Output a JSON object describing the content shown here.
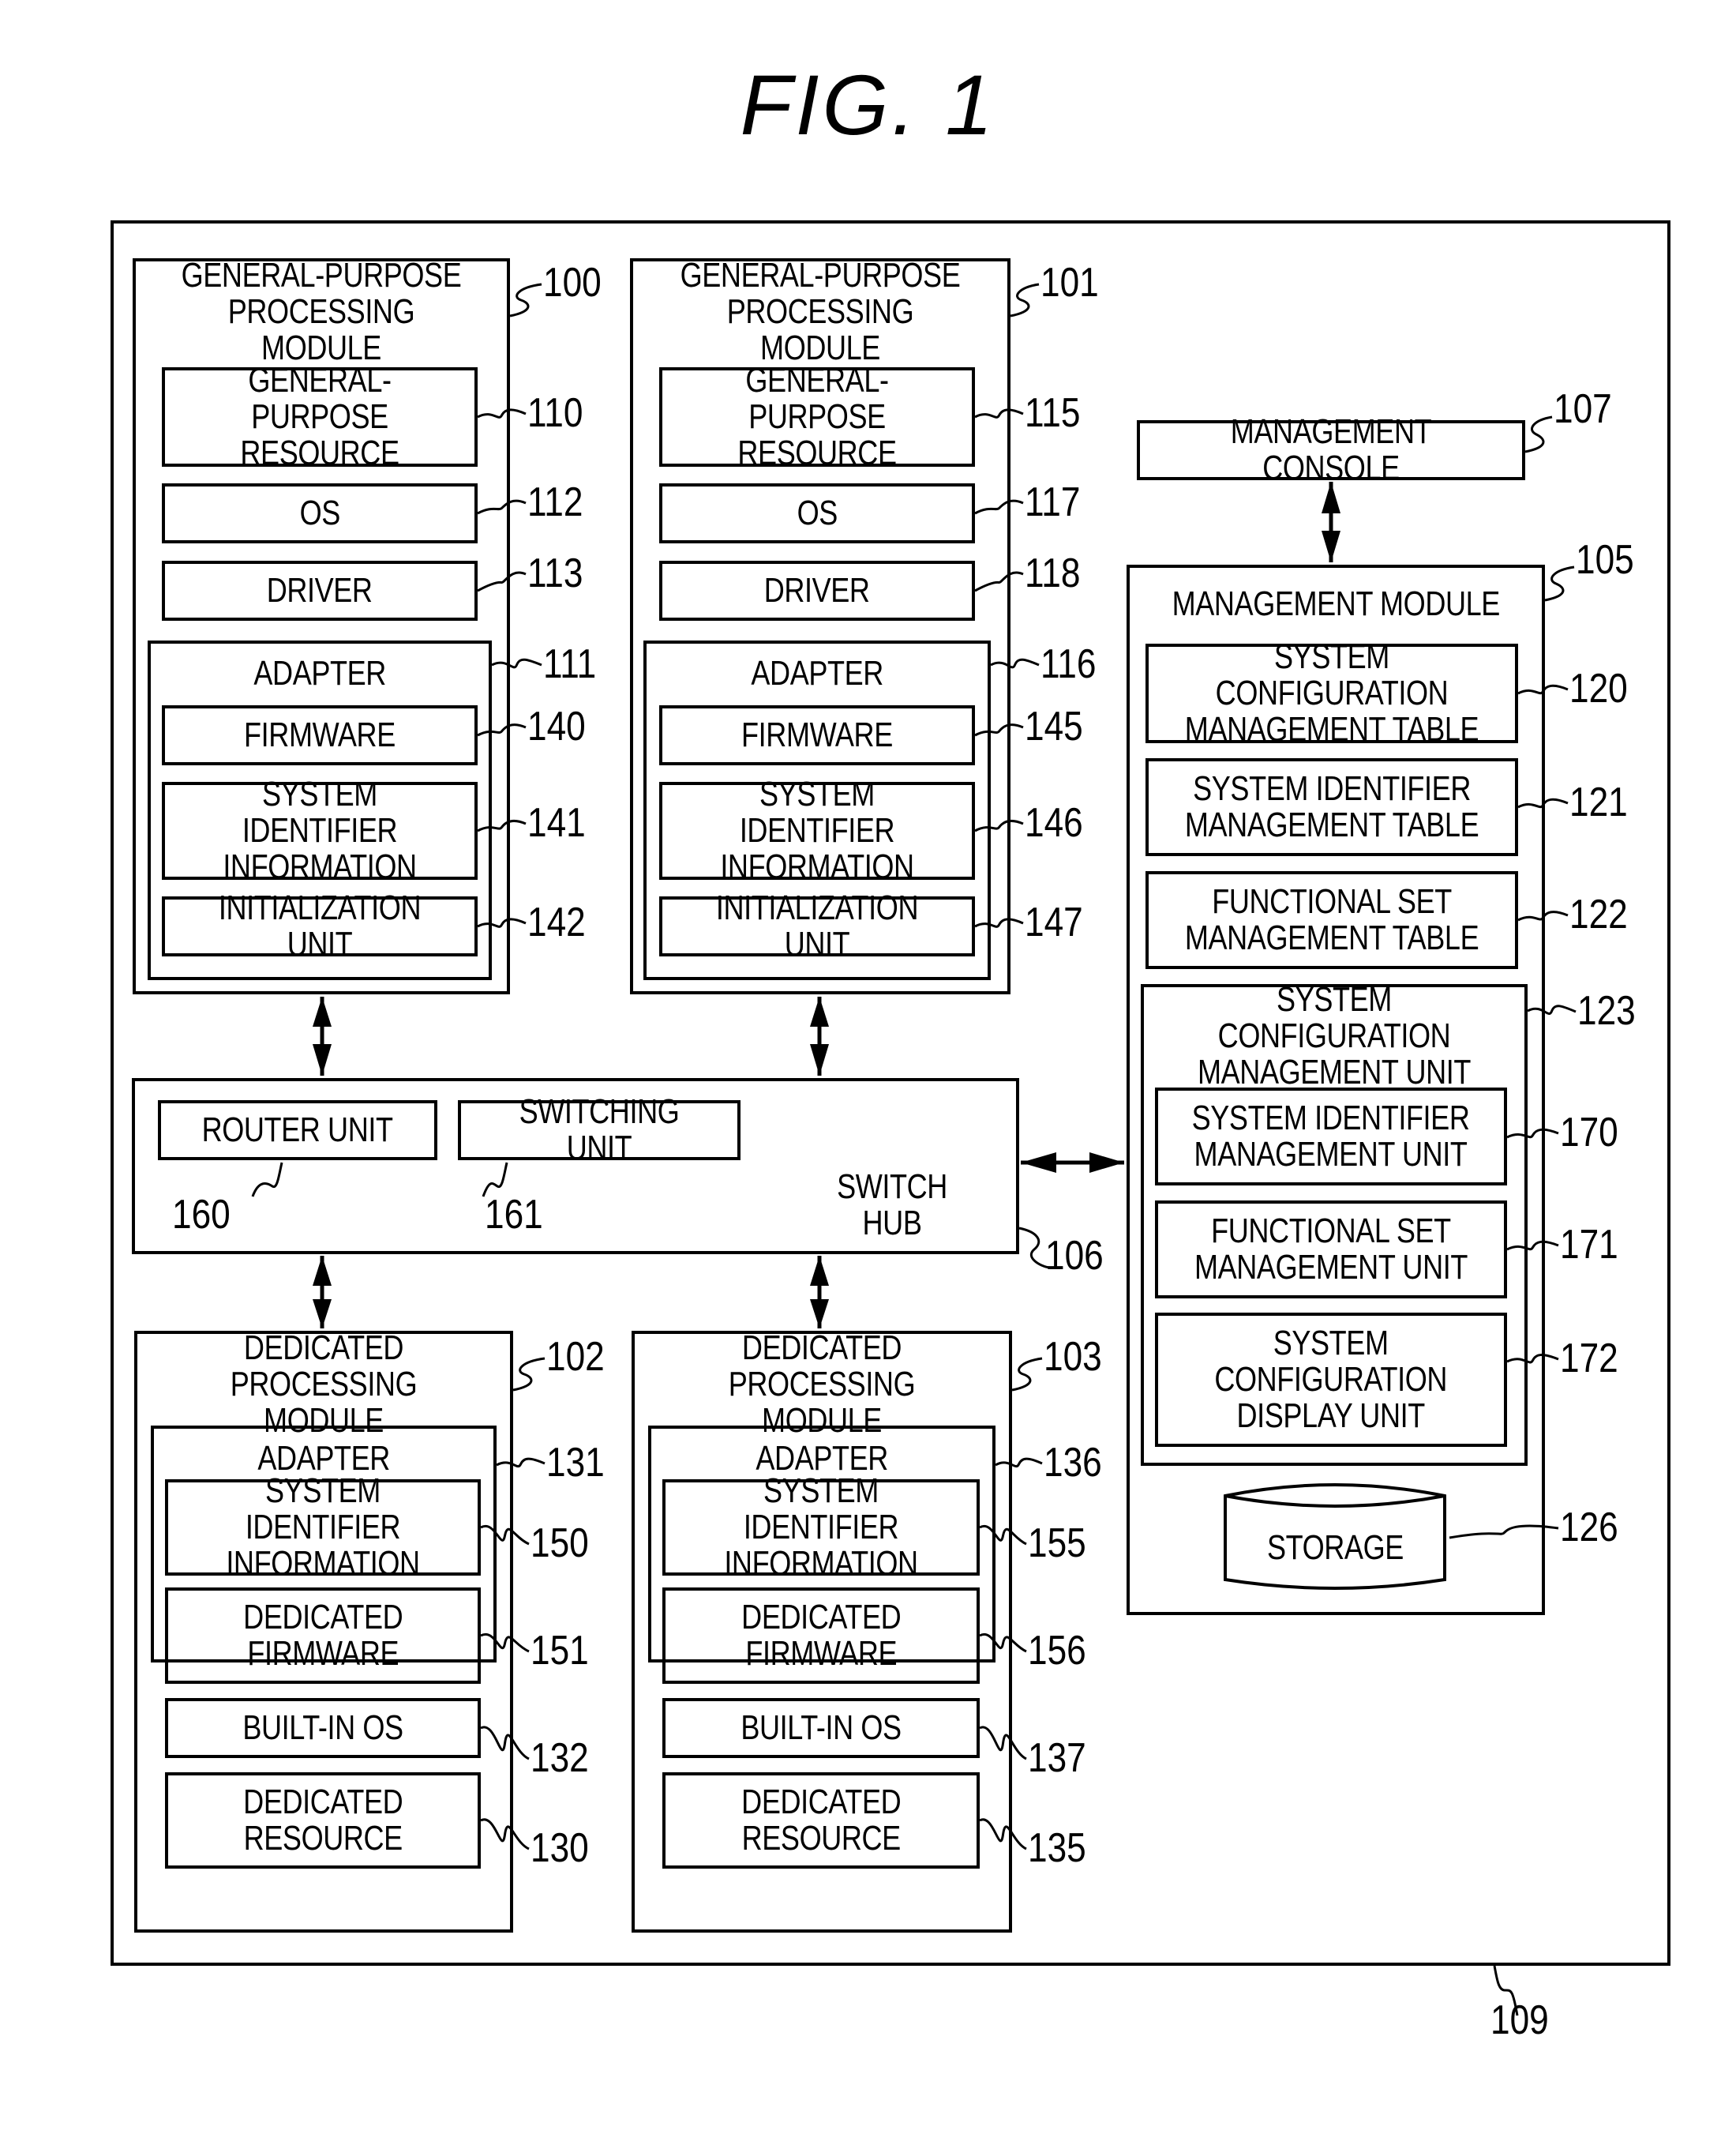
{
  "figure_title": "FIG.  1",
  "system": {
    "ref": "109"
  },
  "gp_modules": [
    {
      "title": "GENERAL-PURPOSE\nPROCESSING MODULE",
      "ref": "100",
      "resource": {
        "label": "GENERAL-PURPOSE\nRESOURCE",
        "ref": "110"
      },
      "os": {
        "label": "OS",
        "ref": "112"
      },
      "driver": {
        "label": "DRIVER",
        "ref": "113"
      },
      "adapter": {
        "label": "ADAPTER",
        "ref": "111",
        "firmware": {
          "label": "FIRMWARE",
          "ref": "140"
        },
        "sysid": {
          "label": "SYSTEM IDENTIFIER\nINFORMATION",
          "ref": "141"
        },
        "init": {
          "label": "INITIALIZATION UNIT",
          "ref": "142"
        }
      }
    },
    {
      "title": "GENERAL-PURPOSE\nPROCESSING MODULE",
      "ref": "101",
      "resource": {
        "label": "GENERAL-PURPOSE\nRESOURCE",
        "ref": "115"
      },
      "os": {
        "label": "OS",
        "ref": "117"
      },
      "driver": {
        "label": "DRIVER",
        "ref": "118"
      },
      "adapter": {
        "label": "ADAPTER",
        "ref": "116",
        "firmware": {
          "label": "FIRMWARE",
          "ref": "145"
        },
        "sysid": {
          "label": "SYSTEM IDENTIFIER\nINFORMATION",
          "ref": "146"
        },
        "init": {
          "label": "INITIALIZATION UNIT",
          "ref": "147"
        }
      }
    }
  ],
  "switch_hub": {
    "label": "SWITCH HUB",
    "ref": "106",
    "router": {
      "label": "ROUTER UNIT",
      "ref": "160"
    },
    "switching": {
      "label": "SWITCHING UNIT",
      "ref": "161"
    }
  },
  "ded_modules": [
    {
      "title": "DEDICATED\nPROCESSING MODULE",
      "ref": "102",
      "adapter": {
        "label": "ADAPTER",
        "ref": "131",
        "sysid": {
          "label": "SYSTEM IDENTIFIER\nINFORMATION",
          "ref": "150"
        },
        "firmware": {
          "label": "DEDICATED\nFIRMWARE",
          "ref": "151"
        }
      },
      "os": {
        "label": "BUILT-IN OS",
        "ref": "132"
      },
      "resource": {
        "label": "DEDICATED\nRESOURCE",
        "ref": "130"
      }
    },
    {
      "title": "DEDICATED\nPROCESSING MODULE",
      "ref": "103",
      "adapter": {
        "label": "ADAPTER",
        "ref": "136",
        "sysid": {
          "label": "SYSTEM IDENTIFIER\nINFORMATION",
          "ref": "155"
        },
        "firmware": {
          "label": "DEDICATED\nFIRMWARE",
          "ref": "156"
        }
      },
      "os": {
        "label": "BUILT-IN OS",
        "ref": "137"
      },
      "resource": {
        "label": "DEDICATED\nRESOURCE",
        "ref": "135"
      }
    }
  ],
  "console": {
    "label": "MANAGEMENT CONSOLE",
    "ref": "107"
  },
  "mgmt": {
    "title": "MANAGEMENT MODULE",
    "ref": "105",
    "sc_table": {
      "label": "SYSTEM CONFIGURATION\nMANAGEMENT TABLE",
      "ref": "120"
    },
    "si_table": {
      "label": "SYSTEM IDENTIFIER\nMANAGEMENT TABLE",
      "ref": "121"
    },
    "fs_table": {
      "label": "FUNCTIONAL SET\nMANAGEMENT TABLE",
      "ref": "122"
    },
    "sc_unit": {
      "label": "SYSTEM CONFIGURATION\nMANAGEMENT UNIT",
      "ref": "123",
      "si_unit": {
        "label": "SYSTEM IDENTIFIER\nMANAGEMENT UNIT",
        "ref": "170"
      },
      "fs_unit": {
        "label": "FUNCTIONAL SET\nMANAGEMENT UNIT",
        "ref": "171"
      },
      "disp_unit": {
        "label": "SYSTEM\nCONFIGURATION\nDISPLAY UNIT",
        "ref": "172"
      }
    },
    "storage": {
      "label": "STORAGE",
      "ref": "126"
    }
  }
}
